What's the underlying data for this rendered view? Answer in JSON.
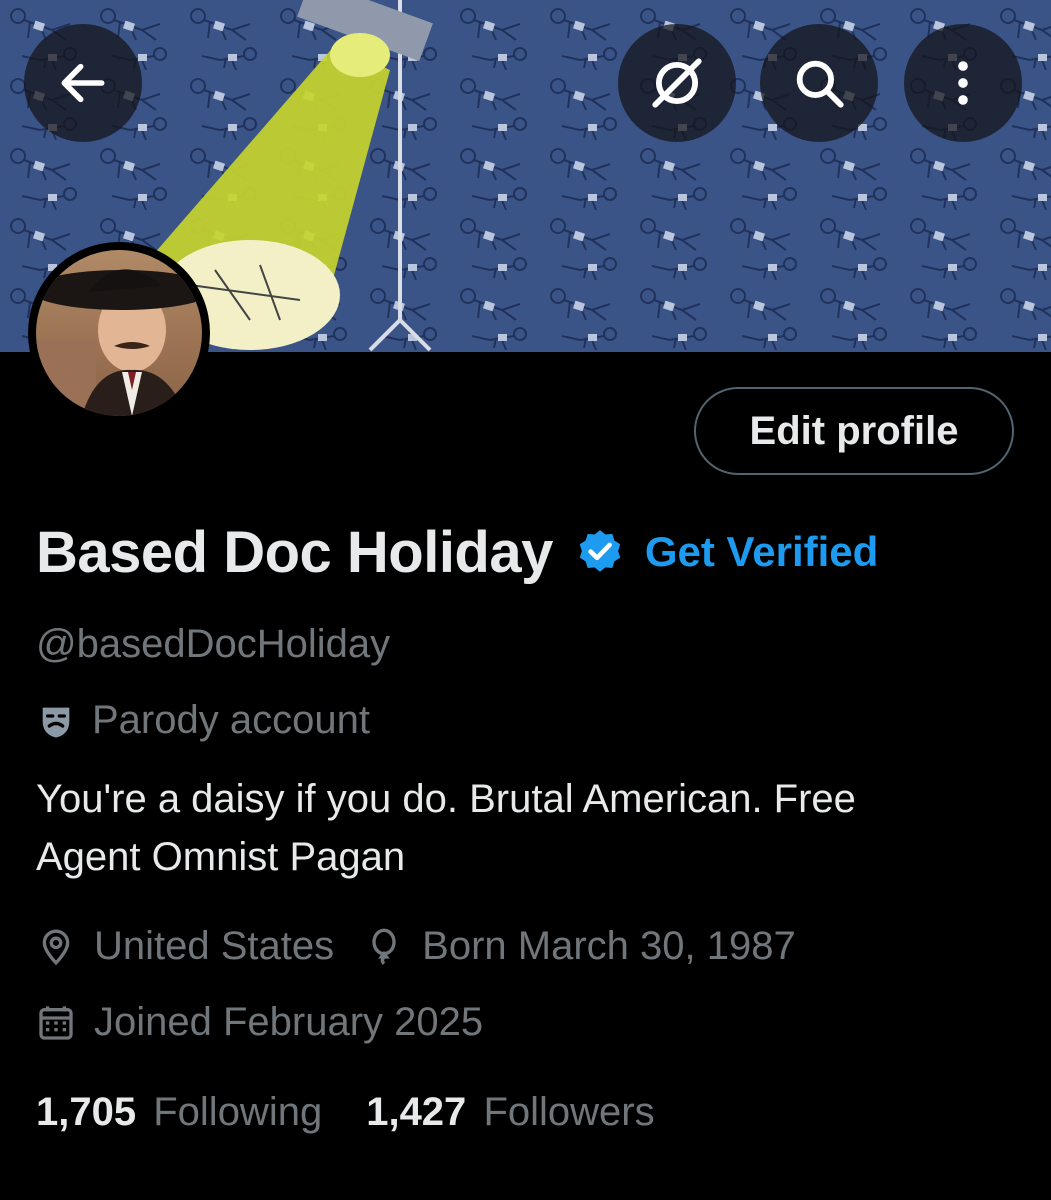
{
  "header": {
    "back_icon": "arrow-left-icon",
    "grok_icon": "grok-icon",
    "search_icon": "search-icon",
    "more_icon": "more-vertical-icon"
  },
  "profile": {
    "edit_label": "Edit profile",
    "name": "Based Doc Holiday",
    "get_verified_label": "Get Verified",
    "handle": "@basedDocHoliday",
    "parody_label": "Parody account",
    "bio_line1": "You're a daisy if you do.  Brutal American.  Free",
    "bio_line2": "Agent  Omnist Pagan",
    "location": "United States",
    "birthday": "Born March 30, 1987",
    "joined": "Joined February 2025",
    "following_count": "1,705",
    "following_label": "Following",
    "followers_count": "1,427",
    "followers_label": "Followers"
  },
  "colors": {
    "background": "#000000",
    "accent": "#1d9bf0",
    "secondary_text": "#71767b",
    "banner_blue": "#3f5a8c",
    "spotlight": "#c7d42c"
  }
}
